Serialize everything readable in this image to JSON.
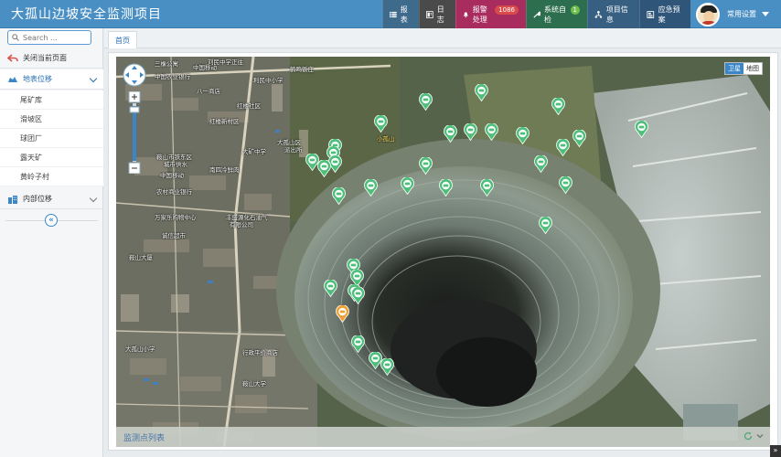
{
  "app": {
    "title": "大孤山边坡安全监测项目"
  },
  "nav": [
    {
      "label": "报表"
    },
    {
      "label": "日志"
    },
    {
      "label": "报警处理",
      "badge": "1086"
    },
    {
      "label": "系统自检",
      "badge": "1"
    },
    {
      "label": "项目信息"
    },
    {
      "label": "应急预案"
    }
  ],
  "user": {
    "menu_label": "常用设置"
  },
  "sidebar": {
    "search_placeholder": "Search ...",
    "close_page": "关闭当前页面",
    "surface": {
      "label": "地表位移",
      "items": [
        "尾矿库",
        "滑坡区",
        "球团厂",
        "露天矿",
        "黄岭子村"
      ]
    },
    "internal": {
      "label": "内部位移"
    }
  },
  "tabs": [
    {
      "label": "首页"
    }
  ],
  "map": {
    "type_satellite": "卫星",
    "type_map": "地图",
    "list_title": "监测点列表",
    "labels": [
      "三橡公寓",
      "中国农业银行",
      "八一商店",
      "红楼社区",
      "红楼新村区",
      "大孤山区",
      "派出所",
      "大矿中学",
      "鞍山市铁东区",
      "城市供水",
      "南四冷鲜肉",
      "中国移动",
      "农村商业银行",
      "万家乐购物中心",
      "丰盛源化石油气",
      "有限公司",
      "诚信超市",
      "鞍山大厦",
      "大孤山小学",
      "鞍山大学",
      "中国移动",
      "利民中小学",
      "鹤鸣饭庄",
      "小孤山",
      "行政平价商店",
      "刘民中学正往"
    ],
    "colors": {
      "marker_green": "#4dbf7a",
      "marker_orange": "#f0a030",
      "header_blue": "#4a8fc3"
    }
  }
}
